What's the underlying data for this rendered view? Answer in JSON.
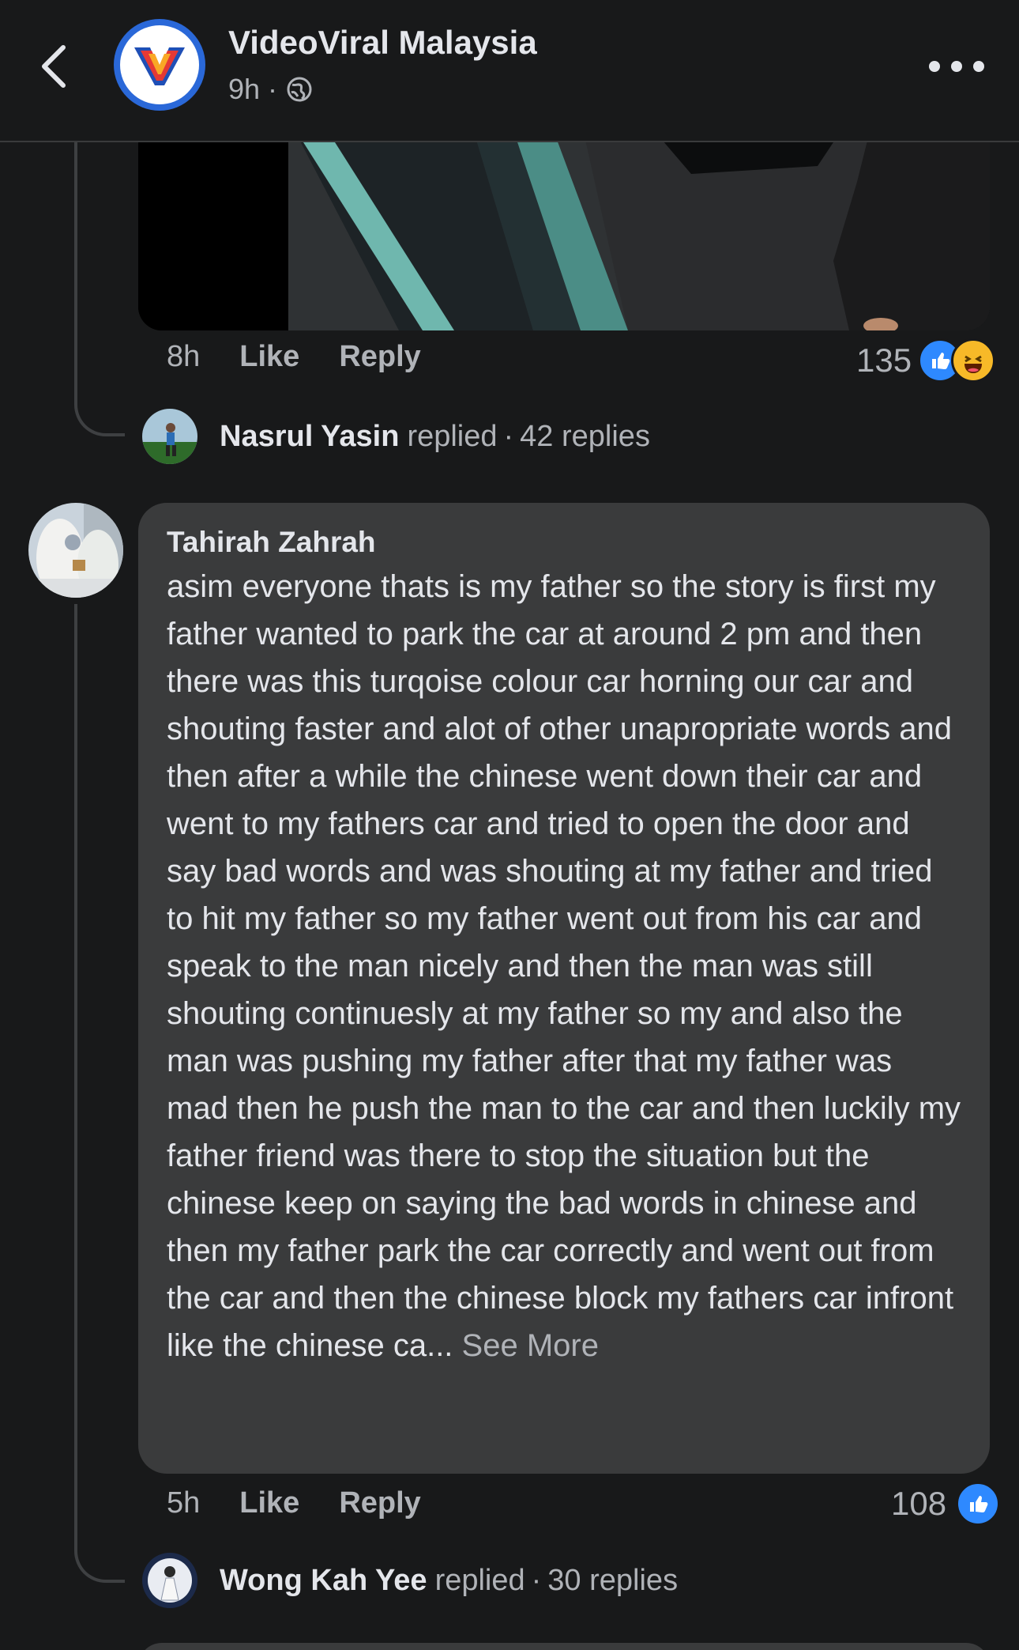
{
  "header": {
    "page_name": "VideoViral Malaysia",
    "time": "9h",
    "dot": "·",
    "back_icon": "chevron-left-icon",
    "more_icon": "more-horizontal-icon",
    "globe_icon": "globe-icon"
  },
  "first_comment": {
    "time": "8h",
    "like": "Like",
    "reply": "Reply",
    "reaction_count": "135",
    "reactions": [
      "like",
      "haha"
    ]
  },
  "reply_summary_1": {
    "name": "Nasrul Yasin",
    "verb": "replied",
    "sep": "·",
    "count": "42 replies"
  },
  "comment": {
    "author": "Tahirah Zahrah",
    "text": "asim everyone thats is my father so the story is first my father wanted to park the car at around 2 pm and then there was this turqoise colour car horning our car and shouting faster and alot of other unapropriate words and then after a while the chinese went down their car and went to my fathers car and tried to open the door and say bad words and was shouting at my father and tried to hit my father so my father went out from his car and speak to the man nicely and then the man was still shouting continuesly at my father so my and also the man was pushing my father after that my father was mad then he push the man to the car and then luckily my father friend was there to stop the situation but the chinese keep on saying the bad words in chinese and then my father park the car correctly and went out from the car and then the chinese block my fathers car infront like the chinese ca...",
    "see_more": "See More",
    "time": "5h",
    "like": "Like",
    "reply": "Reply",
    "reaction_count": "108",
    "reactions": [
      "like"
    ]
  },
  "reply_summary_2": {
    "name": "Wong Kah Yee",
    "verb": "replied",
    "sep": "·",
    "count": "30 replies"
  },
  "colors": {
    "background": "#18191a",
    "bubble": "#3a3b3c",
    "text_primary": "#e4e6eb",
    "text_secondary": "#b0b3b8",
    "like_blue": "#2e89ff",
    "haha_yellow": "#f7b928",
    "avatar_ring": "#2a68d8"
  }
}
